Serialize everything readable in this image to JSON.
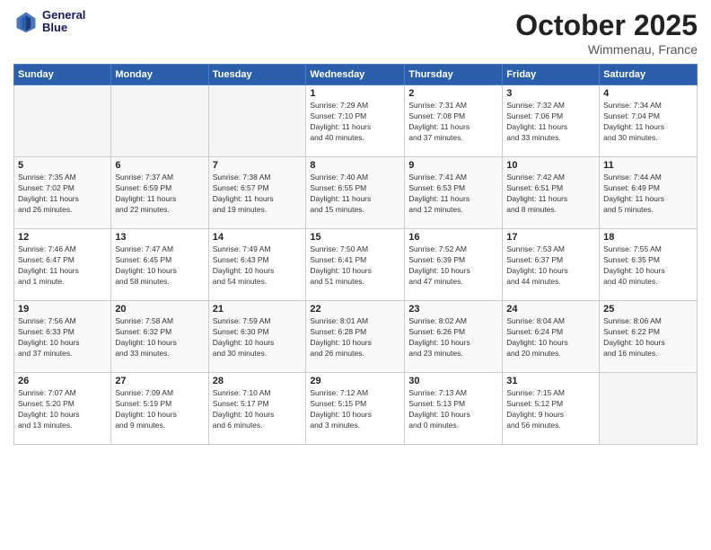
{
  "header": {
    "logo": {
      "line1": "General",
      "line2": "Blue"
    },
    "month": "October 2025",
    "location": "Wimmenau, France"
  },
  "weekdays": [
    "Sunday",
    "Monday",
    "Tuesday",
    "Wednesday",
    "Thursday",
    "Friday",
    "Saturday"
  ],
  "weeks": [
    [
      {
        "day": "",
        "info": ""
      },
      {
        "day": "",
        "info": ""
      },
      {
        "day": "",
        "info": ""
      },
      {
        "day": "1",
        "info": "Sunrise: 7:29 AM\nSunset: 7:10 PM\nDaylight: 11 hours\nand 40 minutes."
      },
      {
        "day": "2",
        "info": "Sunrise: 7:31 AM\nSunset: 7:08 PM\nDaylight: 11 hours\nand 37 minutes."
      },
      {
        "day": "3",
        "info": "Sunrise: 7:32 AM\nSunset: 7:06 PM\nDaylight: 11 hours\nand 33 minutes."
      },
      {
        "day": "4",
        "info": "Sunrise: 7:34 AM\nSunset: 7:04 PM\nDaylight: 11 hours\nand 30 minutes."
      }
    ],
    [
      {
        "day": "5",
        "info": "Sunrise: 7:35 AM\nSunset: 7:02 PM\nDaylight: 11 hours\nand 26 minutes."
      },
      {
        "day": "6",
        "info": "Sunrise: 7:37 AM\nSunset: 6:59 PM\nDaylight: 11 hours\nand 22 minutes."
      },
      {
        "day": "7",
        "info": "Sunrise: 7:38 AM\nSunset: 6:57 PM\nDaylight: 11 hours\nand 19 minutes."
      },
      {
        "day": "8",
        "info": "Sunrise: 7:40 AM\nSunset: 6:55 PM\nDaylight: 11 hours\nand 15 minutes."
      },
      {
        "day": "9",
        "info": "Sunrise: 7:41 AM\nSunset: 6:53 PM\nDaylight: 11 hours\nand 12 minutes."
      },
      {
        "day": "10",
        "info": "Sunrise: 7:42 AM\nSunset: 6:51 PM\nDaylight: 11 hours\nand 8 minutes."
      },
      {
        "day": "11",
        "info": "Sunrise: 7:44 AM\nSunset: 6:49 PM\nDaylight: 11 hours\nand 5 minutes."
      }
    ],
    [
      {
        "day": "12",
        "info": "Sunrise: 7:46 AM\nSunset: 6:47 PM\nDaylight: 11 hours\nand 1 minute."
      },
      {
        "day": "13",
        "info": "Sunrise: 7:47 AM\nSunset: 6:45 PM\nDaylight: 10 hours\nand 58 minutes."
      },
      {
        "day": "14",
        "info": "Sunrise: 7:49 AM\nSunset: 6:43 PM\nDaylight: 10 hours\nand 54 minutes."
      },
      {
        "day": "15",
        "info": "Sunrise: 7:50 AM\nSunset: 6:41 PM\nDaylight: 10 hours\nand 51 minutes."
      },
      {
        "day": "16",
        "info": "Sunrise: 7:52 AM\nSunset: 6:39 PM\nDaylight: 10 hours\nand 47 minutes."
      },
      {
        "day": "17",
        "info": "Sunrise: 7:53 AM\nSunset: 6:37 PM\nDaylight: 10 hours\nand 44 minutes."
      },
      {
        "day": "18",
        "info": "Sunrise: 7:55 AM\nSunset: 6:35 PM\nDaylight: 10 hours\nand 40 minutes."
      }
    ],
    [
      {
        "day": "19",
        "info": "Sunrise: 7:56 AM\nSunset: 6:33 PM\nDaylight: 10 hours\nand 37 minutes."
      },
      {
        "day": "20",
        "info": "Sunrise: 7:58 AM\nSunset: 6:32 PM\nDaylight: 10 hours\nand 33 minutes."
      },
      {
        "day": "21",
        "info": "Sunrise: 7:59 AM\nSunset: 6:30 PM\nDaylight: 10 hours\nand 30 minutes."
      },
      {
        "day": "22",
        "info": "Sunrise: 8:01 AM\nSunset: 6:28 PM\nDaylight: 10 hours\nand 26 minutes."
      },
      {
        "day": "23",
        "info": "Sunrise: 8:02 AM\nSunset: 6:26 PM\nDaylight: 10 hours\nand 23 minutes."
      },
      {
        "day": "24",
        "info": "Sunrise: 8:04 AM\nSunset: 6:24 PM\nDaylight: 10 hours\nand 20 minutes."
      },
      {
        "day": "25",
        "info": "Sunrise: 8:06 AM\nSunset: 6:22 PM\nDaylight: 10 hours\nand 16 minutes."
      }
    ],
    [
      {
        "day": "26",
        "info": "Sunrise: 7:07 AM\nSunset: 5:20 PM\nDaylight: 10 hours\nand 13 minutes."
      },
      {
        "day": "27",
        "info": "Sunrise: 7:09 AM\nSunset: 5:19 PM\nDaylight: 10 hours\nand 9 minutes."
      },
      {
        "day": "28",
        "info": "Sunrise: 7:10 AM\nSunset: 5:17 PM\nDaylight: 10 hours\nand 6 minutes."
      },
      {
        "day": "29",
        "info": "Sunrise: 7:12 AM\nSunset: 5:15 PM\nDaylight: 10 hours\nand 3 minutes."
      },
      {
        "day": "30",
        "info": "Sunrise: 7:13 AM\nSunset: 5:13 PM\nDaylight: 10 hours\nand 0 minutes."
      },
      {
        "day": "31",
        "info": "Sunrise: 7:15 AM\nSunset: 5:12 PM\nDaylight: 9 hours\nand 56 minutes."
      },
      {
        "day": "",
        "info": ""
      }
    ]
  ]
}
